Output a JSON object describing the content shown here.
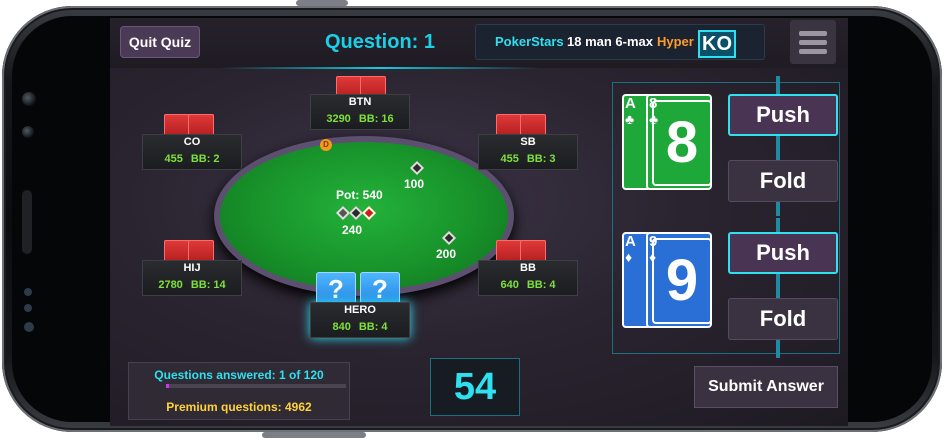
{
  "header": {
    "quit_label": "Quit Quiz",
    "question_label": "Question: 1",
    "game_site": "PokerStars",
    "game_format": "18 man 6-max",
    "game_speed": "Hyper",
    "game_type_badge": "KO",
    "menu_icon": "hamburger-menu-icon"
  },
  "table": {
    "pot_label": "Pot: 540",
    "pot_chips": "240",
    "dealer_button": "D",
    "bets": [
      {
        "seat": "SB",
        "amount": "100"
      },
      {
        "seat": "BB",
        "amount": "200"
      }
    ],
    "seats": [
      {
        "name": "BTN",
        "stack": "3290",
        "bb": "BB: 16"
      },
      {
        "name": "CO",
        "stack": "455",
        "bb": "BB: 2"
      },
      {
        "name": "SB",
        "stack": "455",
        "bb": "BB: 3"
      },
      {
        "name": "HIJ",
        "stack": "2780",
        "bb": "BB: 14"
      },
      {
        "name": "BB",
        "stack": "640",
        "bb": "BB: 4"
      },
      {
        "name": "HERO",
        "stack": "840",
        "bb": "BB: 4"
      }
    ],
    "hero_cards": [
      "?",
      "?"
    ]
  },
  "answers": [
    {
      "cards": [
        {
          "rank": "A",
          "suit": "♣"
        },
        {
          "rank": "8",
          "suit": "♣"
        }
      ],
      "big_rank": "8",
      "color": "#1ea83a",
      "push_label": "Push",
      "fold_label": "Fold"
    },
    {
      "cards": [
        {
          "rank": "A",
          "suit": "♦"
        },
        {
          "rank": "9",
          "suit": "♦"
        }
      ],
      "big_rank": "9",
      "color": "#2a6fd6",
      "push_label": "Push",
      "fold_label": "Fold"
    }
  ],
  "footer": {
    "questions_answered": "Questions answered: 1 of 120",
    "progress_fraction": 0.0083,
    "premium_questions": "Premium questions: 4962",
    "timer": "54",
    "submit_label": "Submit Answer"
  },
  "colors": {
    "accent": "#2fe0f0",
    "stack_green": "#7ee03c",
    "hyper_orange": "#ff9b2b",
    "premium_yellow": "#ffd23a"
  }
}
